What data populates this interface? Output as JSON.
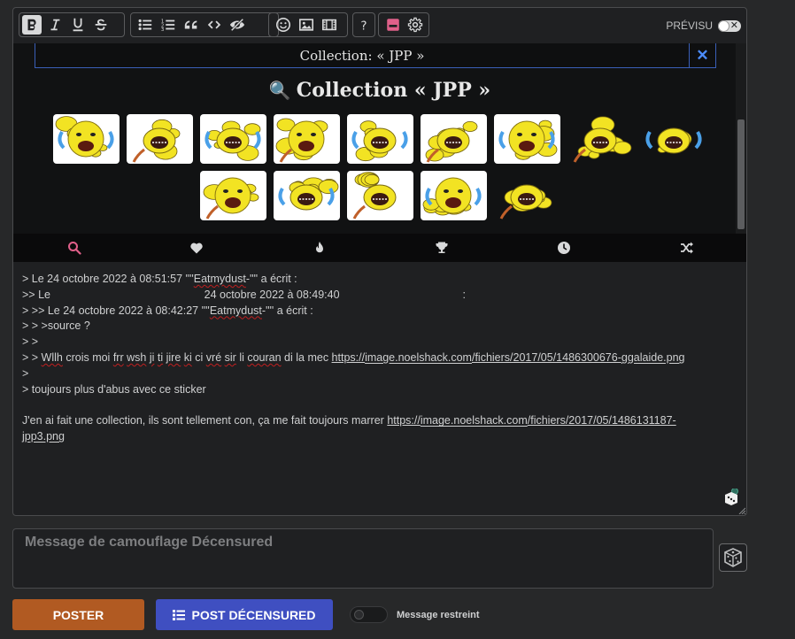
{
  "toolbar": {
    "format_icons": [
      "bold-icon",
      "italic-icon",
      "underline-icon",
      "strikethrough-icon"
    ],
    "list_icons": [
      "bullet-list-icon",
      "numbered-list-icon",
      "quote-icon",
      "code-icon",
      "spoiler-icon"
    ],
    "media_icons": [
      "emoji-icon",
      "image-icon",
      "video-icon"
    ],
    "help_icon": "help-icon",
    "sticker_icon": "sticker-icon",
    "settings_icon": "settings-icon",
    "preview_label": "PRÉVISU",
    "preview_enabled": false
  },
  "sticker_panel": {
    "search_value": "Collection: « JPP »",
    "clear_label": "✕",
    "collection_icon": "🔍",
    "collection_title": "Collection « JPP »",
    "sticker_count": 14,
    "tabs": [
      "search-tab",
      "favorites-tab",
      "trending-tab",
      "top-tab",
      "recent-tab",
      "random-tab"
    ]
  },
  "message": {
    "lines": [
      {
        "parts": [
          {
            "t": "> Le 24 octobre 2022 à 08:51:57 '\"'"
          },
          {
            "t": "Eatmydust",
            "s": 1
          },
          {
            "t": "-'\"' a écrit :"
          }
        ]
      },
      {
        "parts": [
          {
            "t": ">> Le                                                  24 octobre 2022 à 08:49:40                                        :"
          }
        ]
      },
      {
        "parts": [
          {
            "t": "> >> Le 24 octobre 2022 à 08:42:27 '\"'"
          },
          {
            "t": "Eatmydust",
            "s": 1
          },
          {
            "t": "-'\"' a écrit :"
          }
        ]
      },
      {
        "parts": [
          {
            "t": "> > >source ?"
          }
        ]
      },
      {
        "parts": [
          {
            "t": "> >"
          }
        ]
      },
      {
        "parts": [
          {
            "t": "> > "
          },
          {
            "t": "Wllh",
            "s": 1
          },
          {
            "t": " crois moi "
          },
          {
            "t": "frr",
            "s": 1
          },
          {
            "t": " "
          },
          {
            "t": "wsh",
            "s": 1
          },
          {
            "t": " "
          },
          {
            "t": "ji",
            "s": 1
          },
          {
            "t": " "
          },
          {
            "t": "ti",
            "s": 1
          },
          {
            "t": " "
          },
          {
            "t": "jire",
            "s": 1
          },
          {
            "t": " "
          },
          {
            "t": "ki",
            "s": 1
          },
          {
            "t": " ci "
          },
          {
            "t": "vré",
            "s": 1
          },
          {
            "t": " "
          },
          {
            "t": "sir",
            "s": 1
          },
          {
            "t": " li "
          },
          {
            "t": "couran",
            "s": 1
          },
          {
            "t": " di la mec "
          },
          {
            "t": "https://",
            "l": 1
          },
          {
            "t": "image.noelshack.com",
            "l": 1,
            "s": 1
          },
          {
            "t": "/fichiers/2017/05/1486300676-",
            "l": 1
          },
          {
            "t": "ggalaide.png",
            "l": 1,
            "s": 1
          }
        ]
      },
      {
        "parts": [
          {
            "t": ">"
          }
        ]
      },
      {
        "parts": [
          {
            "t": "> toujours plus d'abus avec ce sticker"
          }
        ]
      },
      {
        "parts": [
          {
            "t": ""
          }
        ]
      },
      {
        "parts": [
          {
            "t": "J'en ai fait une collection, ils sont tellement con, ça me fait toujours marrer "
          },
          {
            "t": "https://",
            "l": 1
          },
          {
            "t": "image.noelshack.com",
            "l": 1,
            "s": 1
          },
          {
            "t": "/fichiers/2017/05/1486131187-",
            "l": 1
          }
        ]
      },
      {
        "parts": [
          {
            "t": "jpp3.png",
            "l": 1,
            "s": 1
          }
        ]
      }
    ]
  },
  "camouflage": {
    "placeholder": "Message de camouflage Décensured",
    "value": ""
  },
  "actions": {
    "post_label": "POSTER",
    "decensured_label": "POST DÉCENSURED",
    "restricted_label": "Message restreint",
    "restricted_enabled": false
  },
  "colors": {
    "post_button": "#b15a22",
    "decensured_button": "#3f4fc1",
    "search_border": "#3a5fb8",
    "sticker_yellow": "#f2e323",
    "tab_search": "#e0608a"
  }
}
